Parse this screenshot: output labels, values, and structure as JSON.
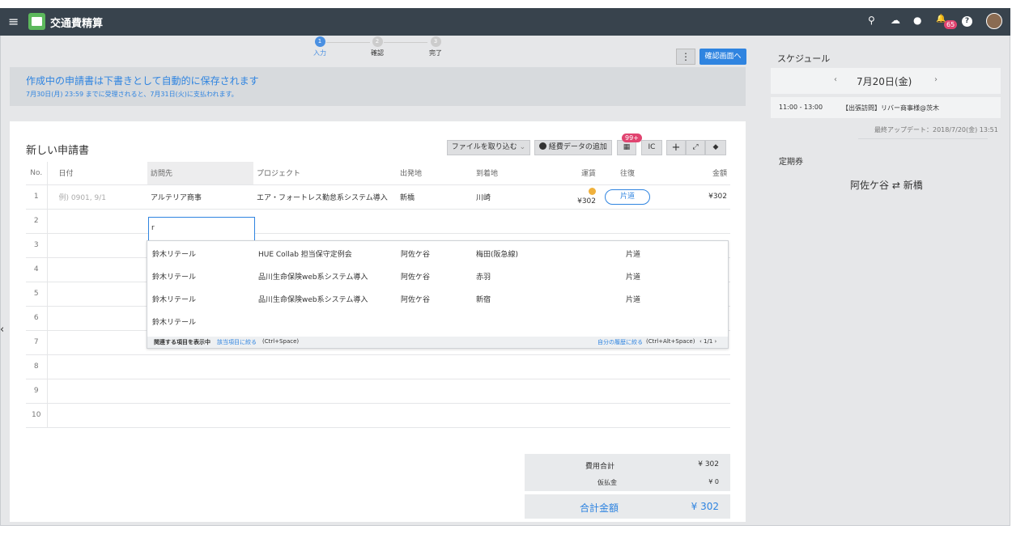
{
  "app": {
    "title": "交通費精算"
  },
  "steps": [
    {
      "num": "1",
      "label": "入力"
    },
    {
      "num": "2",
      "label": "確認"
    },
    {
      "num": "3",
      "label": "完了"
    }
  ],
  "header": {
    "kebab": "⋮",
    "confirm_button": "確認画面へ",
    "notification_count": "65"
  },
  "notice": {
    "headline": "作成中の申請書は下書きとして自動的に保存されます",
    "subline": "7月30日(月) 23:59 までに受理されると、7月31日(火)に支払われます。"
  },
  "form": {
    "title": "新しい申請書",
    "toolbar": {
      "import_file": "ファイルを取り込む",
      "add_expense": "経費データの追加",
      "badge": "99+",
      "ic": "IC",
      "add": "+",
      "expand": "⤢",
      "eraser": "◆"
    },
    "columns": [
      "No.",
      "日付",
      "訪問先",
      "プロジェクト",
      "出発地",
      "到着地",
      "運賃",
      "往復",
      "金額"
    ],
    "row1": {
      "no": "1",
      "date_placeholder": "例) 0901, 9/1",
      "visit": "アルテリア商事",
      "project": "エア・フォートレス勤怠系システム導入",
      "from": "新橋",
      "to": "川崎",
      "fare": "¥302",
      "roundtrip": "片道",
      "amount": "¥302"
    },
    "row_numbers": [
      "2",
      "3",
      "4",
      "5",
      "6",
      "7",
      "8",
      "9",
      "10"
    ],
    "active_input_value": "r"
  },
  "suggestions": {
    "items": [
      {
        "visit": "鈴木リテール",
        "project": "HUE Collab 担当保守定例会",
        "from": "阿佐ケ谷",
        "to": "梅田(阪急線)",
        "trip": "片道"
      },
      {
        "visit": "鈴木リテール",
        "project": "品川生命保険web系システム導入",
        "from": "阿佐ケ谷",
        "to": "赤羽",
        "trip": "片道"
      },
      {
        "visit": "鈴木リテール",
        "project": "品川生命保険web系システム導入",
        "from": "阿佐ケ谷",
        "to": "新宿",
        "trip": "片道"
      },
      {
        "visit": "鈴木リテール",
        "project": "",
        "from": "",
        "to": "",
        "trip": ""
      }
    ],
    "footer_left_bold": "関連する項目を表示中",
    "footer_left_link": "該当項目に絞る",
    "footer_left_shortcut": "(Ctrl+Space)",
    "footer_right_link": "自分の履歴に絞る",
    "footer_right_shortcut": "(Ctrl+Alt+Space)",
    "footer_page": "‹ 1/1 ›"
  },
  "totals": {
    "expense_label": "費用合計",
    "expense_value": "¥ 302",
    "advance_label": "仮払金",
    "advance_value": "¥ 0",
    "total_label": "合計金額",
    "total_value": "¥ 302"
  },
  "sidebar": {
    "schedule_title": "スケジュール",
    "date": "7月20日(金)",
    "prev": "‹",
    "next": "›",
    "event_time": "11:00 - 13:00",
    "event_title": "【出張訪問】リバー商事様@茨木",
    "last_update": "最終アップデート：2018/7/20(金) 13:51",
    "commuter_title": "定期券",
    "commuter_from": "阿佐ケ谷",
    "commuter_arrow": "⇄",
    "commuter_to": "新橋"
  },
  "icons": {
    "menu": "≡",
    "search": "⚲",
    "inbox": "☁",
    "chat": "●",
    "bell": "🔔",
    "help": "?"
  }
}
